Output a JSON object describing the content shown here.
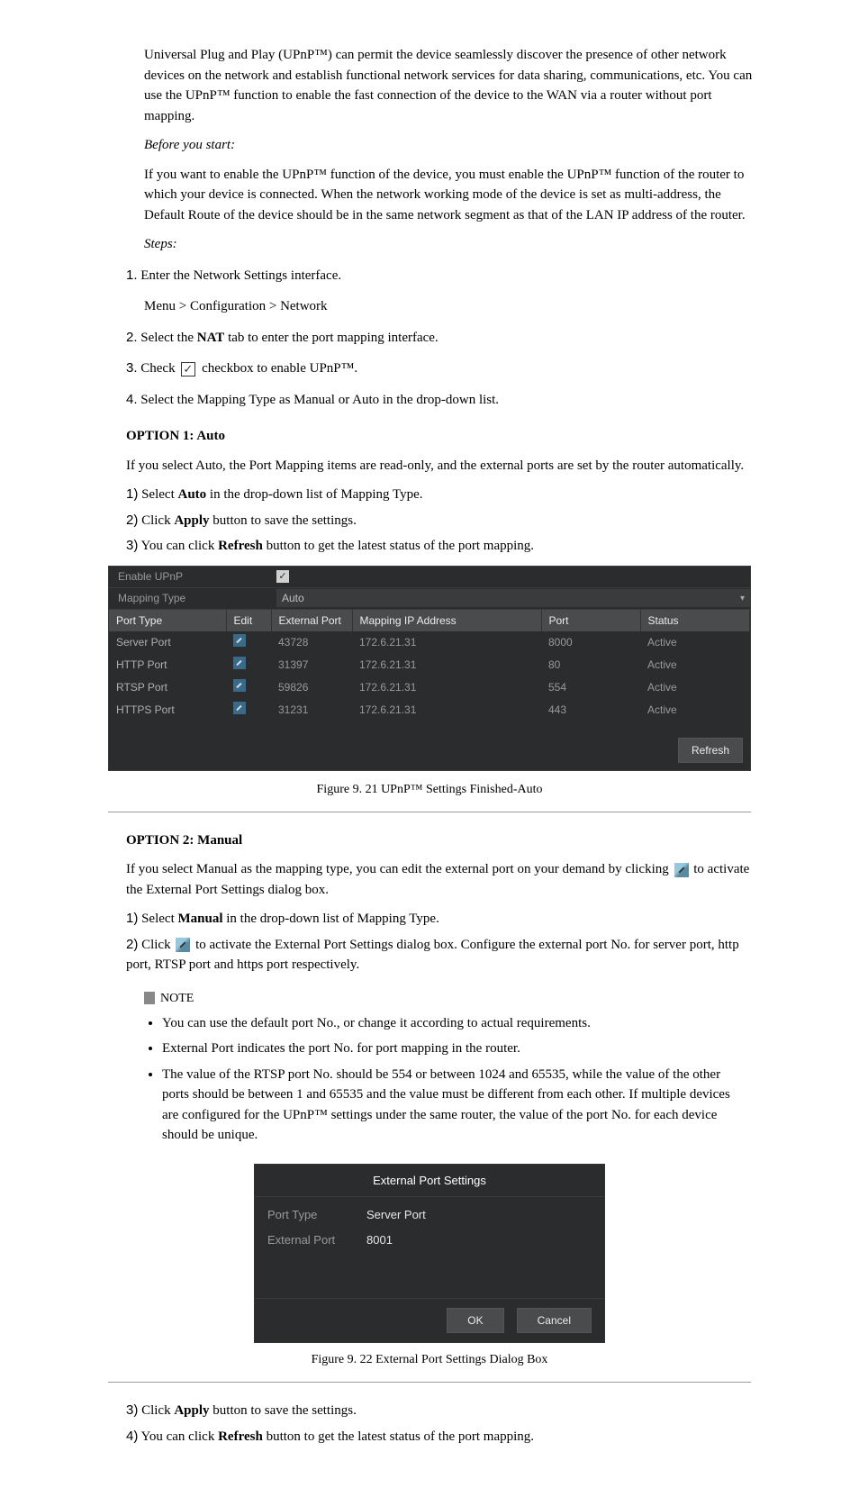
{
  "intro": "If you want to enable the UPnP™ function of the device, you must enable the UPnP™ function of the router to which your device is connected. When the network working mode of the device is set as multi-address, the Default Route of the device should be in the same network segment as that of the LAN IP address of the router.",
  "upnp_desc": "Universal Plug and Play (UPnP™) can permit the device seamlessly discover the presence of other network devices on the network and establish functional network services for data sharing, communications, etc. You can use the UPnP™ function to enable the fast connection of the device to the WAN via a router without port mapping.",
  "before_start_label": "Before you start:",
  "steps_label": "Steps:",
  "s1": {
    "n": "1.",
    "l1": "Enter the Network Settings interface.",
    "l2": "Menu > Configuration > Network"
  },
  "s2": {
    "n": "2.",
    "l": "Select the NAT tab to enter the port mapping interface."
  },
  "s3": {
    "n": "3.",
    "p1": "Check ",
    "p2": " checkbox to enable UPnP™."
  },
  "s4": {
    "n": "4.",
    "l1": "Select the Mapping Type as Manual or Auto in the drop-down list.",
    "opt1": "OPTION 1: Auto",
    "opt1_desc": "If you select Auto, the Port Mapping items are read-only, and the external ports are set by the router automatically.",
    "a1": "1) Select Auto in the drop-down list of Mapping Type.",
    "a2": "2) Click Apply button to save the settings.",
    "a3": "3) You can click Refresh button to get the latest status of the port mapping."
  },
  "panel1": {
    "enable_label": "Enable UPnP",
    "mapping_label": "Mapping Type",
    "mapping_value": "Auto",
    "headers": {
      "pt": "Port Type",
      "edit": "Edit",
      "ext": "External Port",
      "map": "Mapping IP Address",
      "port": "Port",
      "status": "Status"
    },
    "rows": [
      {
        "pt": "Server Port",
        "ext": "43728",
        "map": "172.6.21.31",
        "port": "8000",
        "status": "Active"
      },
      {
        "pt": "HTTP Port",
        "ext": "31397",
        "map": "172.6.21.31",
        "port": "80",
        "status": "Active"
      },
      {
        "pt": "RTSP Port",
        "ext": "59826",
        "map": "172.6.21.31",
        "port": "554",
        "status": "Active"
      },
      {
        "pt": "HTTPS Port",
        "ext": "31231",
        "map": "172.6.21.31",
        "port": "443",
        "status": "Active"
      }
    ],
    "refresh": "Refresh"
  },
  "fig1": "Figure 9. 21 UPnP™ Settings Finished-Auto",
  "opt2": "OPTION 2: Manual",
  "opt2_desc_p1": "If you select Manual as the mapping type, you can edit the external port on your demand by clicking ",
  "opt2_desc_p2": " to activate the External Port Settings dialog box.",
  "m1": "1) Select Manual in the drop-down list of Mapping Type.",
  "m2_p1": "2) Click ",
  "m2_p2": " to activate the External Port Settings dialog box. Configure the external port No. for server port, http port, RTSP port and https port respectively.",
  "note_label": "NOTE",
  "note_items": [
    "You can use the default port No., or change it according to actual requirements.",
    "External Port indicates the port No. for port mapping in the router.",
    "The value of the RTSP port No. should be 554 or between 1024 and 65535, while the value of the other ports should be between 1 and 65535 and the value must be different from each other. If multiple devices are configured for the UPnP™ settings under the same router, the value of the port No. for each device should be unique."
  ],
  "dialog": {
    "title": "External Port Settings",
    "pt_label": "Port Type",
    "pt_value": "Server Port",
    "ext_label": "External Port",
    "ext_value": "8001",
    "ok": "OK",
    "cancel": "Cancel"
  },
  "fig2": "Figure 9. 22 External Port Settings Dialog Box",
  "m3": "3) Click Apply button to save the settings.",
  "m4": "4) You can click Refresh button to get the latest status of the port mapping."
}
